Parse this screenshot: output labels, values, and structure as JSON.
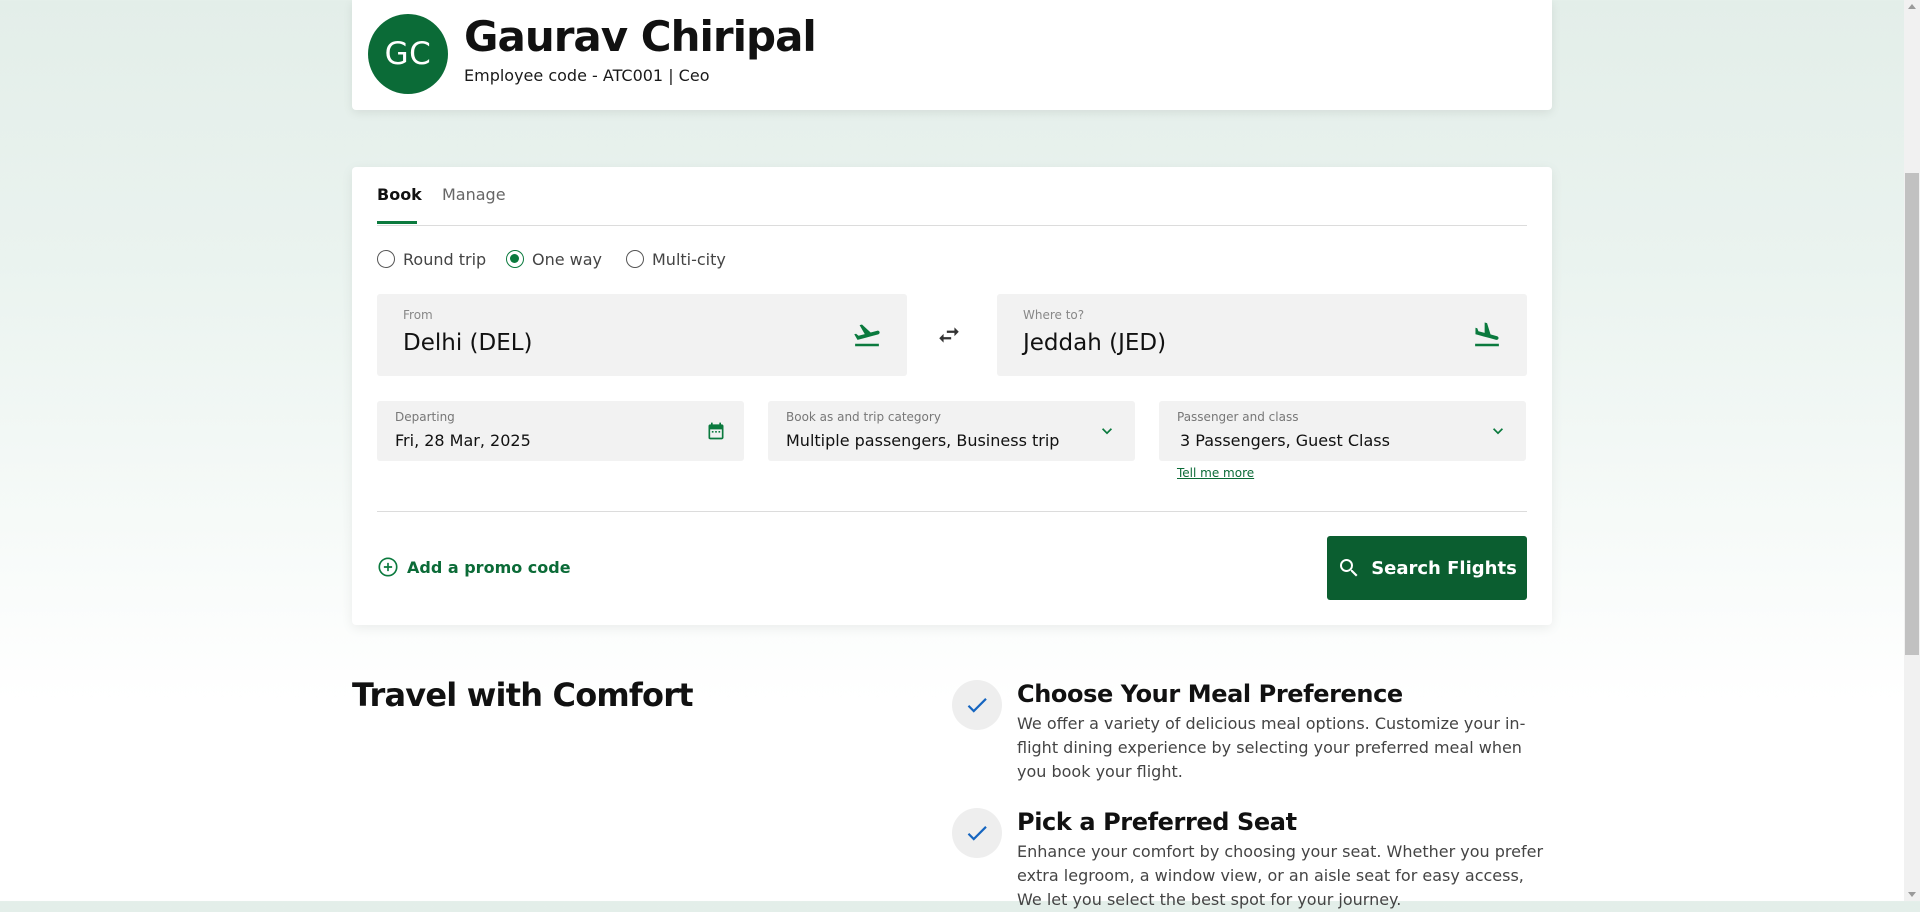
{
  "profile": {
    "initials": "GC",
    "name": "Gaurav Chiripal",
    "employee_meta": "Employee code - ATC001 | Ceo"
  },
  "booking": {
    "tabs": [
      {
        "label": "Book",
        "active": true
      },
      {
        "label": "Manage",
        "active": false
      }
    ],
    "trip_types": [
      {
        "label": "Round trip",
        "selected": false
      },
      {
        "label": "One way",
        "selected": true
      },
      {
        "label": "Multi-city",
        "selected": false
      }
    ],
    "from": {
      "label": "From",
      "value": "Delhi (DEL)",
      "icon": "plane-takeoff-icon"
    },
    "to": {
      "label": "Where to?",
      "value": "Jeddah (JED)",
      "icon": "plane-landing-icon"
    },
    "swap_icon": "swap-arrows-icon",
    "departing": {
      "label": "Departing",
      "value": "Fri, 28 Mar, 2025",
      "icon": "calendar-icon"
    },
    "category": {
      "label": "Book as and trip category",
      "value": "Multiple passengers, Business trip"
    },
    "passengers": {
      "label": "Passenger and class",
      "value": "3 Passengers, Guest Class"
    },
    "tell_more": "Tell me more",
    "promo_label": "Add a promo code",
    "search_label": "Search Flights"
  },
  "comfort": {
    "title": "Travel with Comfort",
    "features": [
      {
        "title": "Choose Your Meal Preference",
        "desc": "We offer a variety of delicious meal options. Customize your in-flight dining experience by selecting your preferred meal when you book your flight."
      },
      {
        "title": "Pick a Preferred Seat",
        "desc": "Enhance your comfort by choosing your seat. Whether you prefer extra legroom, a window view, or an aisle seat for easy access, We let you select the best spot for your journey."
      }
    ]
  },
  "colors": {
    "brand_green": "#0b6b37",
    "button_green": "#0b5e30",
    "check_blue": "#1565c0"
  }
}
